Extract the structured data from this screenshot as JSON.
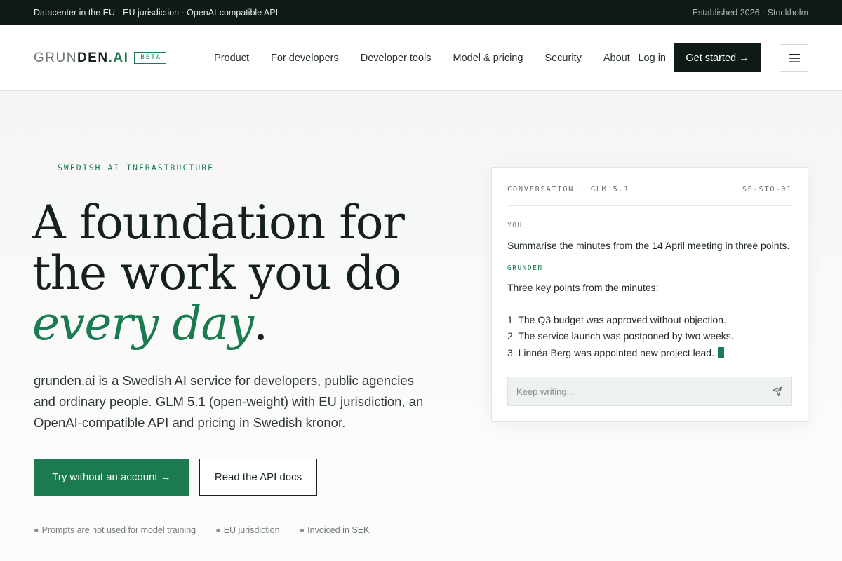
{
  "topbar": {
    "left": "Datacenter in the EU · EU jurisdiction · OpenAI-compatible API",
    "right": "Established 2026 · Stockholm"
  },
  "brand": {
    "name_light": "GRUN",
    "name_bold": "DEN",
    "name_ai": ".AI",
    "badge": "BETA",
    "accent_color": "#1b7a4f",
    "dark_color": "#0f1a15"
  },
  "nav": {
    "items": [
      "Product",
      "For developers",
      "Developer tools",
      "Model & pricing",
      "Security",
      "About"
    ],
    "login": "Log in",
    "cta": "Get started →",
    "menu_icon": "hamburger-icon"
  },
  "hero": {
    "eyebrow": "SWEDISH AI INFRASTRUCTURE",
    "headline_line1": "A foundation for",
    "headline_line2": "the work you do",
    "headline_accent": "every day",
    "headline_period": ".",
    "lede": "grunden.ai is a Swedish AI service for developers, public agencies and ordinary people. GLM 5.1 (open-weight) with EU jurisdiction, an OpenAI-compatible API and pricing in Swedish kronor.",
    "primary_cta": "Try without an account →",
    "secondary_cta": "Read the API docs",
    "trust": [
      "Prompts are not used for model training",
      "EU jurisdiction",
      "Invoiced in SEK"
    ]
  },
  "chat": {
    "title": "CONVERSATION · GLM 5.1",
    "region": "SE-STO-01",
    "user_role": "YOU",
    "user_message": "Summarise the minutes from the 14 April meeting in three points.",
    "bot_role": "GRUNDEN",
    "bot_intro": "Three key points from the minutes:",
    "bot_points": [
      "1. The Q3 budget was approved without objection.",
      "2. The service launch was postponed by two weeks.",
      "3. Linnéa Berg was appointed new project lead."
    ],
    "composer_placeholder": "Keep writing...",
    "send_icon": "send-icon"
  }
}
